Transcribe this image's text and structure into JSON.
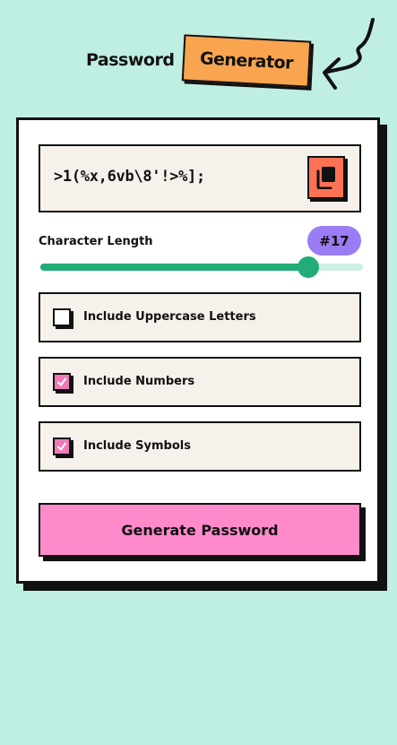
{
  "header": {
    "title_word": "Password",
    "tag_word": "Generator"
  },
  "password": {
    "value": ">1(%x,6vb\\8'!>%];"
  },
  "icons": {
    "copy": "copy-icon",
    "check": "check-icon",
    "squiggle": "squiggle-arrow-icon"
  },
  "length": {
    "label": "Character Length",
    "badge": "#17",
    "slider_fraction": 0.83
  },
  "options": [
    {
      "label": "Include Uppercase Letters",
      "checked": false
    },
    {
      "label": "Include Numbers",
      "checked": true
    },
    {
      "label": "Include Symbols",
      "checked": true
    }
  ],
  "actions": {
    "generate_label": "Generate Password"
  },
  "colors": {
    "background": "#bfeee3",
    "tag": "#f9a54f",
    "copy_button": "#ff7155",
    "badge": "#9a7cf4",
    "slider": "#22ad78",
    "checkbox_on": "#f07ab8",
    "generate_button": "#ff8acb"
  }
}
